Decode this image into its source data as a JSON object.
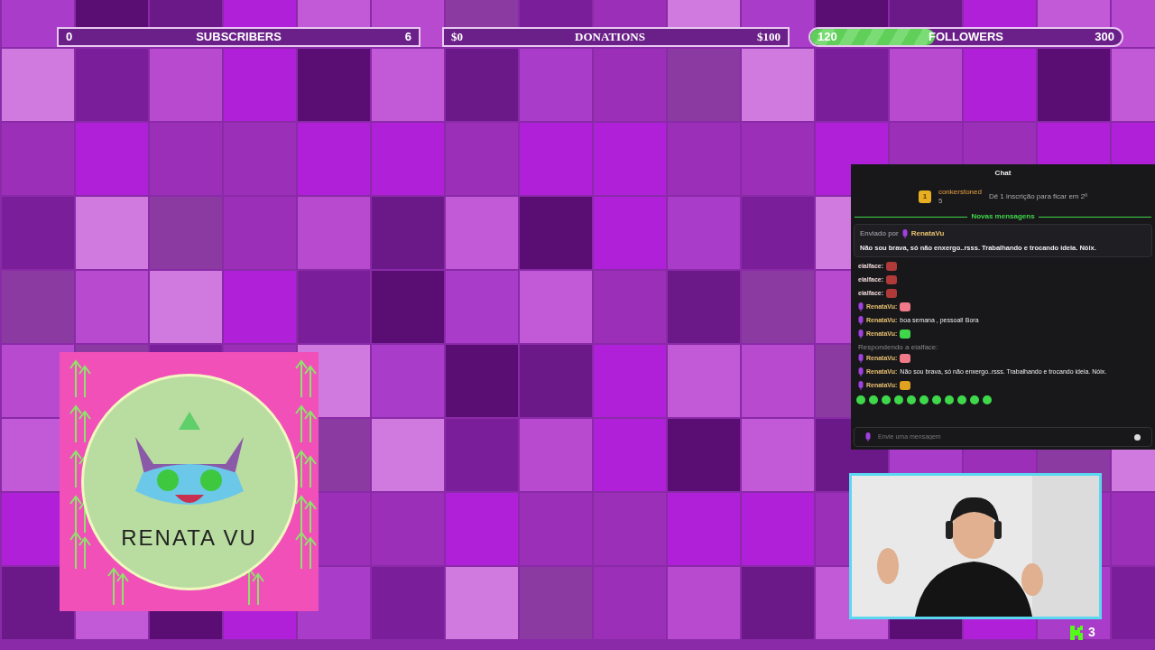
{
  "goals": [
    {
      "kind": "square",
      "start": "0",
      "label": "SUBSCRIBERS",
      "end": "6"
    },
    {
      "kind": "serif",
      "start": "$0",
      "label": "DONATIONS",
      "end": "$100"
    },
    {
      "kind": "pill",
      "start": "120",
      "label": "FOLLOWERS",
      "end": "300",
      "level": 0.4
    }
  ],
  "logo": {
    "name": "RENATA VU"
  },
  "chat": {
    "title": "Chat",
    "leader": {
      "rank": "1",
      "user": "conkerstoned",
      "count": "5",
      "hint": "Dê 1 inscrição para ficar em 2º"
    },
    "divider": "Novas mensagens",
    "pinned": {
      "label": "Enviado por",
      "user": "RenataVu",
      "text": "Não sou brava, só não enxergo..rsss. Trabalhando e trocando ideia. Nóix."
    },
    "messages": [
      {
        "user": "eialface:",
        "broadcaster": false,
        "kind": "emote",
        "color": "#b03a3a"
      },
      {
        "user": "eialface:",
        "broadcaster": false,
        "kind": "emote",
        "color": "#b03a3a"
      },
      {
        "user": "eialface:",
        "broadcaster": false,
        "kind": "emote",
        "color": "#b03a3a"
      },
      {
        "user": "RenataVu:",
        "broadcaster": true,
        "kind": "emote",
        "color": "#f07a8a"
      },
      {
        "user": "RenataVu:",
        "broadcaster": true,
        "kind": "text",
        "text": "boa semana , pessoal! Bora"
      },
      {
        "user": "RenataVu:",
        "broadcaster": true,
        "kind": "emote",
        "color": "#3fd84a"
      },
      {
        "user": "RenataVu:",
        "broadcaster": true,
        "kind": "emote",
        "color": "#f07a8a",
        "reply": "Respondendo a eialface:"
      },
      {
        "user": "RenataVu:",
        "broadcaster": true,
        "kind": "text",
        "text": "Não sou brava, só não enxergo..rsss. Trabalhando e trocando ideia. Nóix."
      },
      {
        "user": "RenataVu:",
        "broadcaster": true,
        "kind": "emote",
        "color": "#e0a020"
      }
    ],
    "input": {
      "placeholder": "Envie uma mensagem"
    }
  },
  "viewers": {
    "count": "3"
  }
}
